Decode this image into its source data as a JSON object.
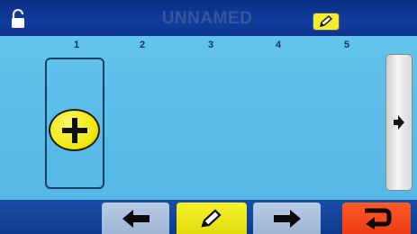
{
  "header": {
    "title": "UNNAMED",
    "lock_icon": "lock-icon",
    "rename_icon": "pencil-icon"
  },
  "columns": [
    "1",
    "2",
    "3",
    "4",
    "5"
  ],
  "slots": {
    "add_icon": "plus-icon"
  },
  "side": {
    "next_icon": "arrow-right-icon"
  },
  "footer": {
    "buttons": [
      {
        "name": "previous",
        "icon": "arrow-left-icon"
      },
      {
        "name": "edit",
        "icon": "pencil-icon"
      },
      {
        "name": "next",
        "icon": "arrow-right-icon"
      },
      {
        "name": "return",
        "icon": "return-icon"
      }
    ]
  },
  "colors": {
    "header_bg": "#0e3590",
    "panel_bg": "#5bbde9",
    "accent_yellow": "#f0e80f",
    "return_red": "#ef3b12"
  }
}
